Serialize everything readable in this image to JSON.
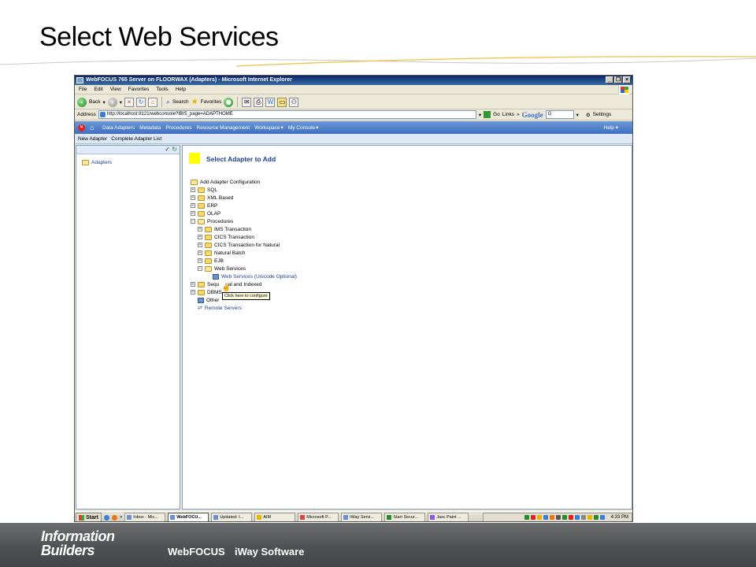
{
  "slide": {
    "title": "Select Web Services",
    "footer_brand": "Information Builders",
    "footer_product_1": "WebFOCUS",
    "footer_product_2": "iWay Software"
  },
  "browser": {
    "window_title": "WebFOCUS 765 Server on FLOORWAX (Adapters) - Microsoft Internet Explorer",
    "menu": [
      "File",
      "Edit",
      "View",
      "Favorites",
      "Tools",
      "Help"
    ],
    "toolbar": {
      "back": "Back",
      "search": "Search",
      "favorites": "Favorites"
    },
    "address": {
      "label": "Address",
      "url": "http://localhost:8121/webconsole?IBIS_page=ADAPTHOME",
      "go": "Go",
      "links": "Links",
      "links_chevron": "»",
      "google": "Google",
      "google_g": "G",
      "settings": "Settings"
    }
  },
  "app": {
    "menu": [
      "Data Adapters",
      "Metadata",
      "Procedures",
      "Resource Management",
      "Workspace",
      "My Console"
    ],
    "help": "Help",
    "subbar": [
      "New Adapter",
      "Complete Adapter List"
    ],
    "left_tree_root": "Adapters",
    "heading": "Select Adapter to Add",
    "tree": {
      "root": "Add Adapter Configuration",
      "sql": "SQL",
      "xml": "XML Based",
      "erp": "ERP",
      "olap": "OLAP",
      "procedures": "Procedures",
      "ims": "IMS Transaction",
      "cics": "CICS Transaction",
      "cics_natural": "CICS Transaction for Natural",
      "natural_batch": "Natural Batch",
      "ejb": "EJB",
      "web_services": "Web Services",
      "web_services_unicode": "Web Services (Unicode Optional)",
      "sequential_a": "Sequ",
      "sequential_b": "ual and Indexed",
      "dbms": "DBMS",
      "other": "Other",
      "remote_servers": "Remote Servers"
    },
    "tooltip": "Click here to configure"
  },
  "taskbar": {
    "start": "Start",
    "items": [
      "Inbox - Mic...",
      "WebFOCU...",
      "Updated: I...",
      "AIM",
      "Microsoft P...",
      "iWay Servi...",
      "Start Secur...",
      "Jasc Paint ..."
    ],
    "clock": "4:33 PM"
  }
}
